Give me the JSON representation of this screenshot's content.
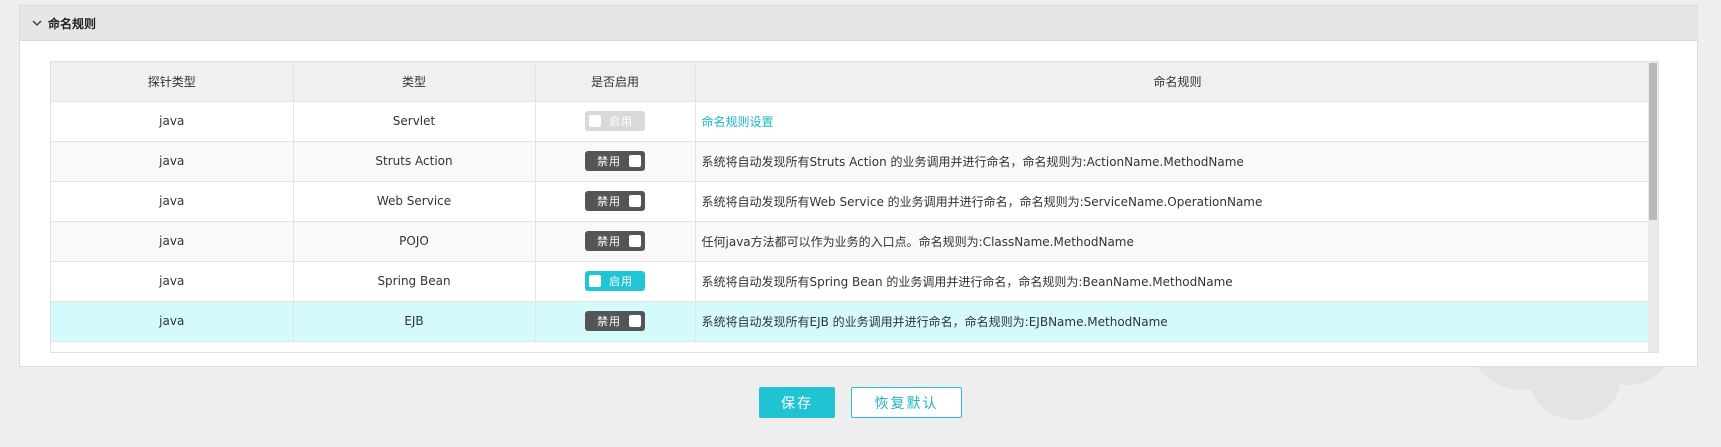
{
  "section": {
    "title": "命名规则"
  },
  "table": {
    "headers": [
      "探针类型",
      "类型",
      "是否启用",
      "命名规则"
    ],
    "rows": [
      {
        "probe": "java",
        "type": "Servlet",
        "toggle": "启用",
        "toggle_state": "disabled",
        "rule": "命名规则设置",
        "rule_is_link": true
      },
      {
        "probe": "java",
        "type": "Struts Action",
        "toggle": "禁用",
        "toggle_state": "off",
        "rule": "系统将自动发现所有Struts Action 的业务调用并进行命名，命名规则为:ActionName.MethodName"
      },
      {
        "probe": "java",
        "type": "Web Service",
        "toggle": "禁用",
        "toggle_state": "off",
        "rule": "系统将自动发现所有Web Service 的业务调用并进行命名，命名规则为:ServiceName.OperationName"
      },
      {
        "probe": "java",
        "type": "POJO",
        "toggle": "禁用",
        "toggle_state": "off",
        "rule": "任何java方法都可以作为业务的入口点。命名规则为:ClassName.MethodName"
      },
      {
        "probe": "java",
        "type": "Spring Bean",
        "toggle": "启用",
        "toggle_state": "on",
        "rule": "系统将自动发现所有Spring Bean 的业务调用并进行命名，命名规则为:BeanName.MethodName"
      },
      {
        "probe": "java",
        "type": "EJB",
        "toggle": "禁用",
        "toggle_state": "off",
        "rule": "系统将自动发现所有EJB 的业务调用并进行命名，命名规则为:EJBName.MethodName",
        "selected": true
      }
    ]
  },
  "buttons": {
    "save": "保存",
    "reset": "恢复默认"
  },
  "colors": {
    "accent": "#1fc3d2",
    "toggle_off": "#555555",
    "selected_row": "#d5fafc"
  }
}
